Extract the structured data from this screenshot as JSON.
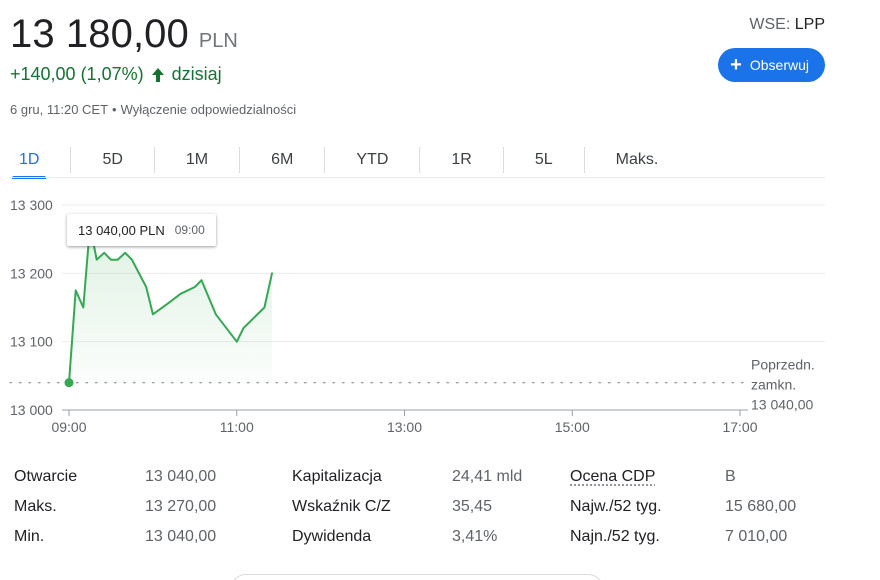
{
  "quote": {
    "price": "13 180,00",
    "currency": "PLN",
    "change": "+140,00 (1,07%)",
    "period": "dzisiaj",
    "timestamp": "6 gru, 11:20 CET",
    "separator": "•",
    "disclaimer": "Wyłączenie odpowiedzialności",
    "exchange": "WSE:",
    "symbol": "LPP",
    "follow_label": "Obserwuj",
    "positive_color": "#137333",
    "accent_color": "#1a73e8",
    "icons": {
      "change_arrow": "arrow-up-icon",
      "follow": "plus-icon"
    }
  },
  "tabs": [
    {
      "label": "1D",
      "active": true
    },
    {
      "label": "5D",
      "active": false
    },
    {
      "label": "1M",
      "active": false
    },
    {
      "label": "6M",
      "active": false
    },
    {
      "label": "YTD",
      "active": false
    },
    {
      "label": "1R",
      "active": false
    },
    {
      "label": "5L",
      "active": false
    },
    {
      "label": "Maks.",
      "active": false
    }
  ],
  "tooltip": {
    "price": "13 040,00 PLN",
    "time": "09:00"
  },
  "chart_data": {
    "type": "line",
    "x_unit": "time of day (hours)",
    "xlim": [
      9,
      17
    ],
    "ylim": [
      13000,
      13300
    ],
    "x_ticks": [
      9,
      11,
      13,
      15,
      17
    ],
    "x_tick_labels": [
      "09:00",
      "11:00",
      "13:00",
      "15:00",
      "17:00"
    ],
    "y_ticks": [
      13000,
      13100,
      13200,
      13300
    ],
    "y_tick_labels": [
      "13 000",
      "13 100",
      "13 200",
      "13 300"
    ],
    "grid": true,
    "line_color": "#34a853",
    "series": [
      {
        "x": [
          9.0,
          9.08,
          9.17,
          9.25,
          9.33,
          9.42,
          9.5,
          9.58,
          9.67,
          9.75,
          9.92,
          10.0,
          10.17,
          10.33,
          10.5,
          10.58,
          10.75,
          11.0,
          11.08,
          11.33,
          11.42
        ],
        "y": [
          13040,
          13175,
          13150,
          13270,
          13220,
          13230,
          13220,
          13220,
          13230,
          13220,
          13180,
          13140,
          13155,
          13170,
          13180,
          13190,
          13140,
          13100,
          13120,
          13150,
          13200
        ]
      }
    ],
    "previous_close": {
      "value": 13040,
      "label_lines": [
        "Poprzedn.",
        "zamkn.",
        "13 040,00"
      ]
    }
  },
  "stats": {
    "col1": [
      {
        "label": "Otwarcie",
        "value": "13 040,00"
      },
      {
        "label": "Maks.",
        "value": "13 270,00"
      },
      {
        "label": "Min.",
        "value": "13 040,00"
      }
    ],
    "col2": [
      {
        "label": "Kapitalizacja",
        "value": "24,41 mld"
      },
      {
        "label": "Wskaźnik C/Z",
        "value": "35,45"
      },
      {
        "label": "Dywidenda",
        "value": "3,41%"
      }
    ],
    "col3": [
      {
        "label": "Ocena CDP",
        "value": "B"
      },
      {
        "label": "Najw./52 tyg.",
        "value": "15 680,00"
      },
      {
        "label": "Najn./52 tyg.",
        "value": "7 010,00"
      }
    ]
  }
}
